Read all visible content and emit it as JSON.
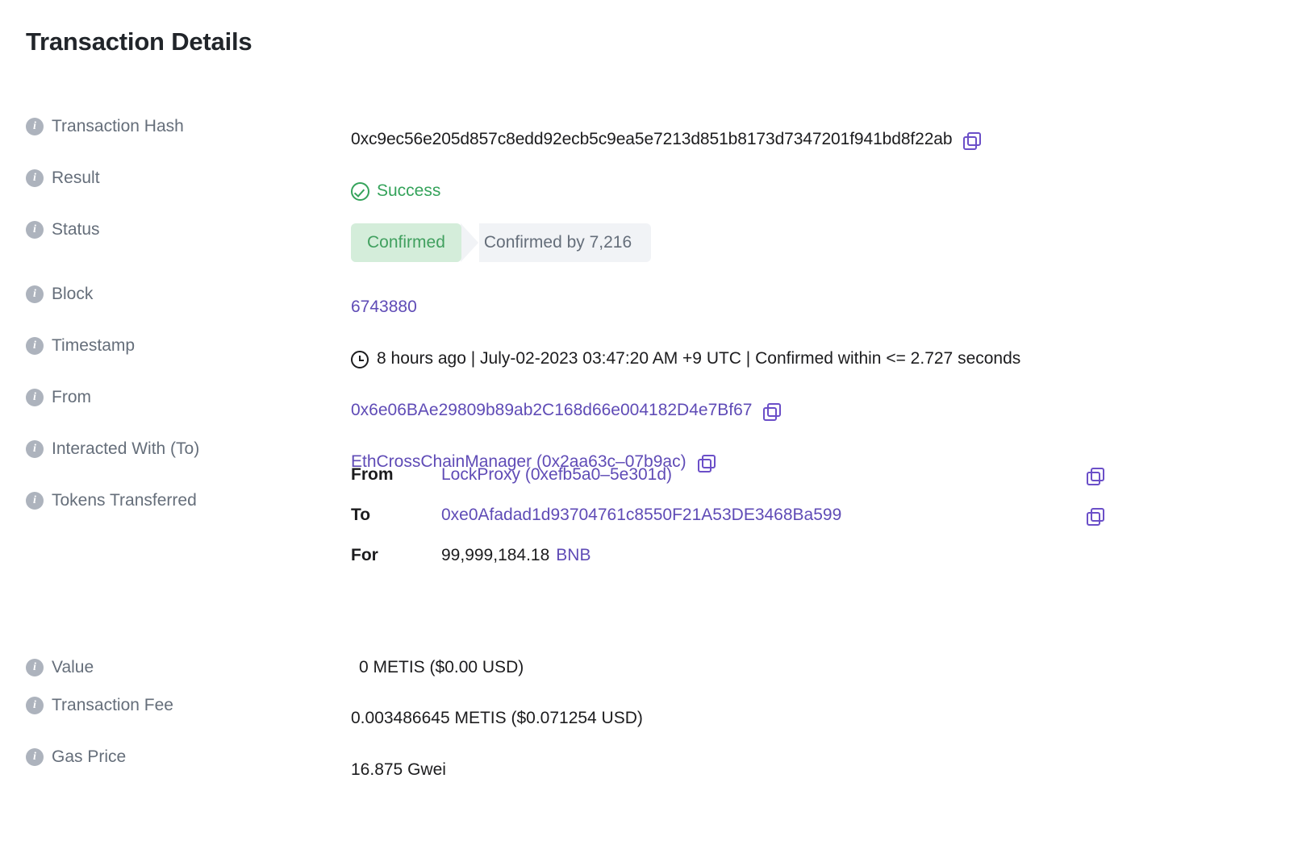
{
  "page": {
    "title": "Transaction Details"
  },
  "colors": {
    "link": "#5f4bb6",
    "success": "#35a35b",
    "confirmed_bg": "#d4edda",
    "confirmed_text": "#41a05f",
    "muted_bg": "#f1f3f6",
    "label": "#656e7a"
  },
  "rows": {
    "transaction_hash": {
      "label": "Transaction Hash",
      "value": "0xc9ec56e205d857c8edd92ecb5c9ea5e7213d851b8173d7347201f941bd8f22ab",
      "copy_icon": "copy-icon"
    },
    "result": {
      "label": "Result",
      "value": "Success",
      "icon": "check-circle-icon"
    },
    "status": {
      "label": "Status",
      "badge": "Confirmed",
      "confirmations": "Confirmed by 7,216"
    },
    "block": {
      "label": "Block",
      "value": "6743880"
    },
    "timestamp": {
      "label": "Timestamp",
      "icon": "clock-icon",
      "value": "8 hours ago | July-02-2023 03:47:20 AM +9 UTC | Confirmed within <= 2.727 seconds"
    },
    "from": {
      "label": "From",
      "value": "0x6e06BAe29809b89ab2C168d66e004182D4e7Bf67",
      "copy_icon": "copy-icon"
    },
    "interacted_with": {
      "label": "Interacted With (To)",
      "value": "EthCrossChainManager (0x2aa63c–07b9ac)",
      "copy_icon": "copy-icon"
    },
    "tokens_transferred": {
      "label": "Tokens Transferred",
      "from_key": "From",
      "from_value": "LockProxy (0xefb5a0–5e301d)",
      "to_key": "To",
      "to_value": "0xe0Afadad1d93704761c8550F21A53DE3468Ba599",
      "for_key": "For",
      "for_amount": "99,999,184.18",
      "for_token": "BNB",
      "copy_icon": "copy-icon"
    },
    "value": {
      "label": "Value",
      "value": "0 METIS ($0.00 USD)"
    },
    "transaction_fee": {
      "label": "Transaction Fee",
      "value": "0.003486645 METIS ($0.071254 USD)"
    },
    "gas_price": {
      "label": "Gas Price",
      "value": "16.875 Gwei"
    }
  },
  "info_icon_glyph": "i"
}
